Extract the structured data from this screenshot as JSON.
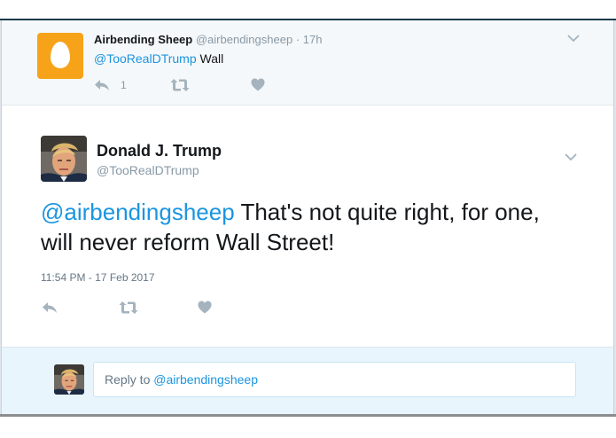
{
  "parent_tweet": {
    "author_name": "Airbending Sheep",
    "author_handle": "@airbendingsheep",
    "time_sep": "·",
    "time_ago": "17h",
    "mention": "@TooRealDTrump",
    "text": "Wall",
    "reply_count": "1",
    "icons": {
      "reply": "reply-icon",
      "retweet": "retweet-icon",
      "like": "heart-icon",
      "menu": "chevron-down-icon"
    }
  },
  "main_tweet": {
    "author_name": "Donald J. Trump",
    "author_handle": "@TooRealDTrump",
    "mention": "@airbendingsheep",
    "text": "That's not quite right, for one, will never reform Wall Street!",
    "timestamp": "11:54 PM - 17 Feb 2017"
  },
  "reply_box": {
    "prefix": "Reply to",
    "mention": "@airbendingsheep"
  },
  "colors": {
    "link": "#1b95e0",
    "muted": "#8899a6",
    "text": "#14171a",
    "reply_bg": "#e8f5fd",
    "avatar_bg": "#f6a31a"
  }
}
